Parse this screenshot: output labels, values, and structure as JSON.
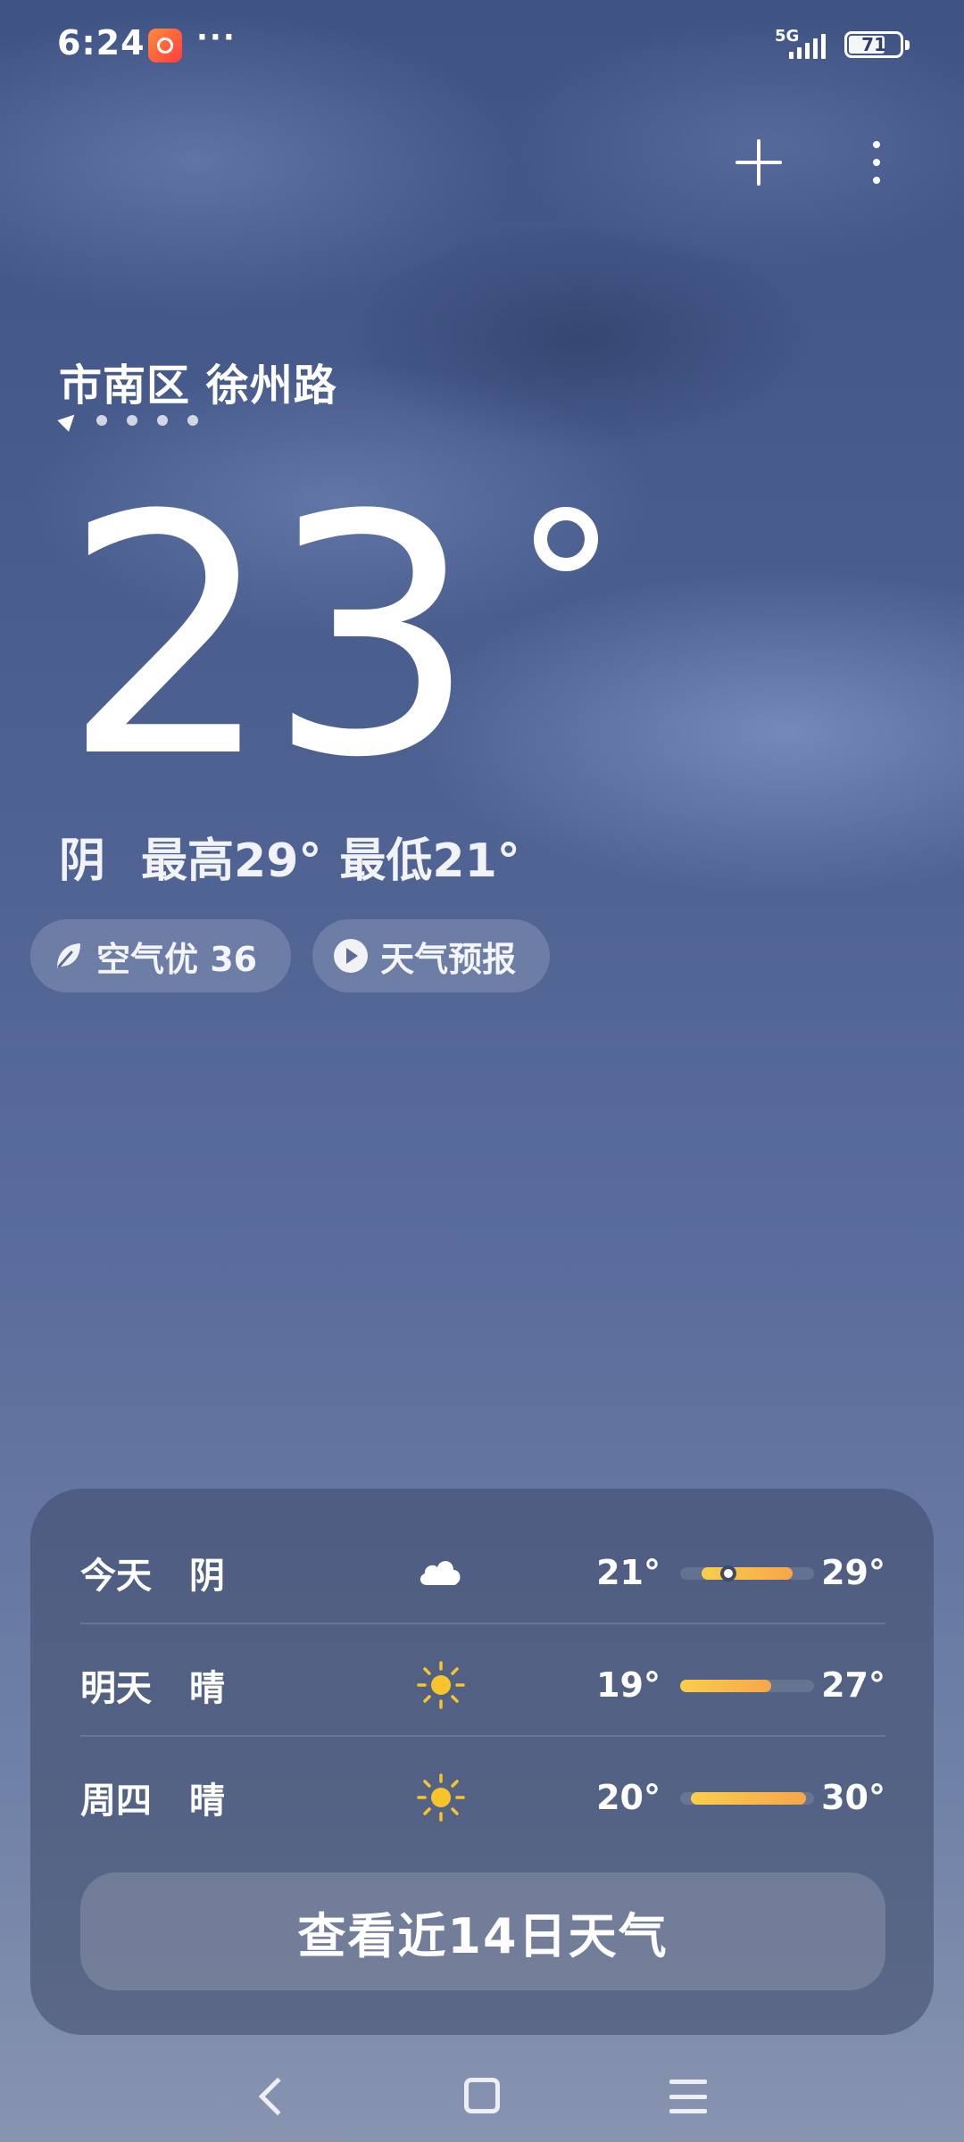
{
  "status_bar": {
    "time": "6:24",
    "more": "···",
    "network": "5G",
    "battery": "71",
    "battery_level": 0.71
  },
  "header": {
    "location": "市南区 徐州路",
    "page_count": 5
  },
  "current": {
    "temperature": "23",
    "condition": "阴",
    "high": "最高29°",
    "low": "最低21°"
  },
  "chips": {
    "air_quality": "空气优 36",
    "forecast_video": "天气预报"
  },
  "forecast": [
    {
      "day": "今天",
      "condition": "阴",
      "icon": "cloud-icon",
      "low": "21°",
      "high": "29°",
      "bar_start": 0.16,
      "bar_end": 0.84,
      "current_marker": 0.36
    },
    {
      "day": "明天",
      "condition": "晴",
      "icon": "sun-icon",
      "low": "19°",
      "high": "27°",
      "bar_start": 0.0,
      "bar_end": 0.68
    },
    {
      "day": "周四",
      "condition": "晴",
      "icon": "sun-icon",
      "low": "20°",
      "high": "30°",
      "bar_start": 0.08,
      "bar_end": 0.94
    }
  ],
  "cta": "查看近14日天气",
  "colors": {
    "sun": "#f9c32b",
    "bar_start": "#f9cf4b",
    "bar_end": "#f7a64a"
  }
}
